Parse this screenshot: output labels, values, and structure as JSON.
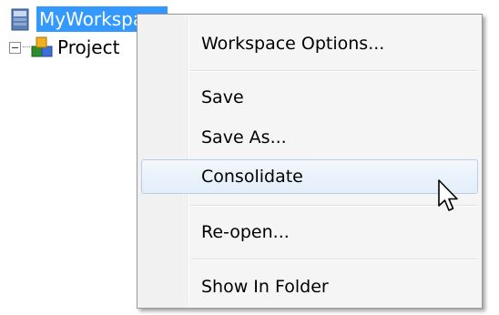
{
  "tree": {
    "workspace_label": "MyWorkspace",
    "project_label": "Project"
  },
  "icons": {
    "workspace": "workspace-server-icon",
    "project": "project-cubes-icon",
    "expander": "collapse-minus-icon",
    "cursor": "mouse-pointer-icon"
  },
  "context_menu": {
    "items": [
      {
        "label": "Workspace Options..."
      },
      {
        "label": "Save"
      },
      {
        "label": "Save As..."
      },
      {
        "label": "Consolidate"
      },
      {
        "label": "Re-open..."
      },
      {
        "label": "Show In Folder"
      }
    ],
    "highlighted_item": "Consolidate"
  },
  "colors": {
    "selection": "#3399ff",
    "menu_background": "#f5f5f5",
    "hover_border": "#b5cfe7"
  }
}
